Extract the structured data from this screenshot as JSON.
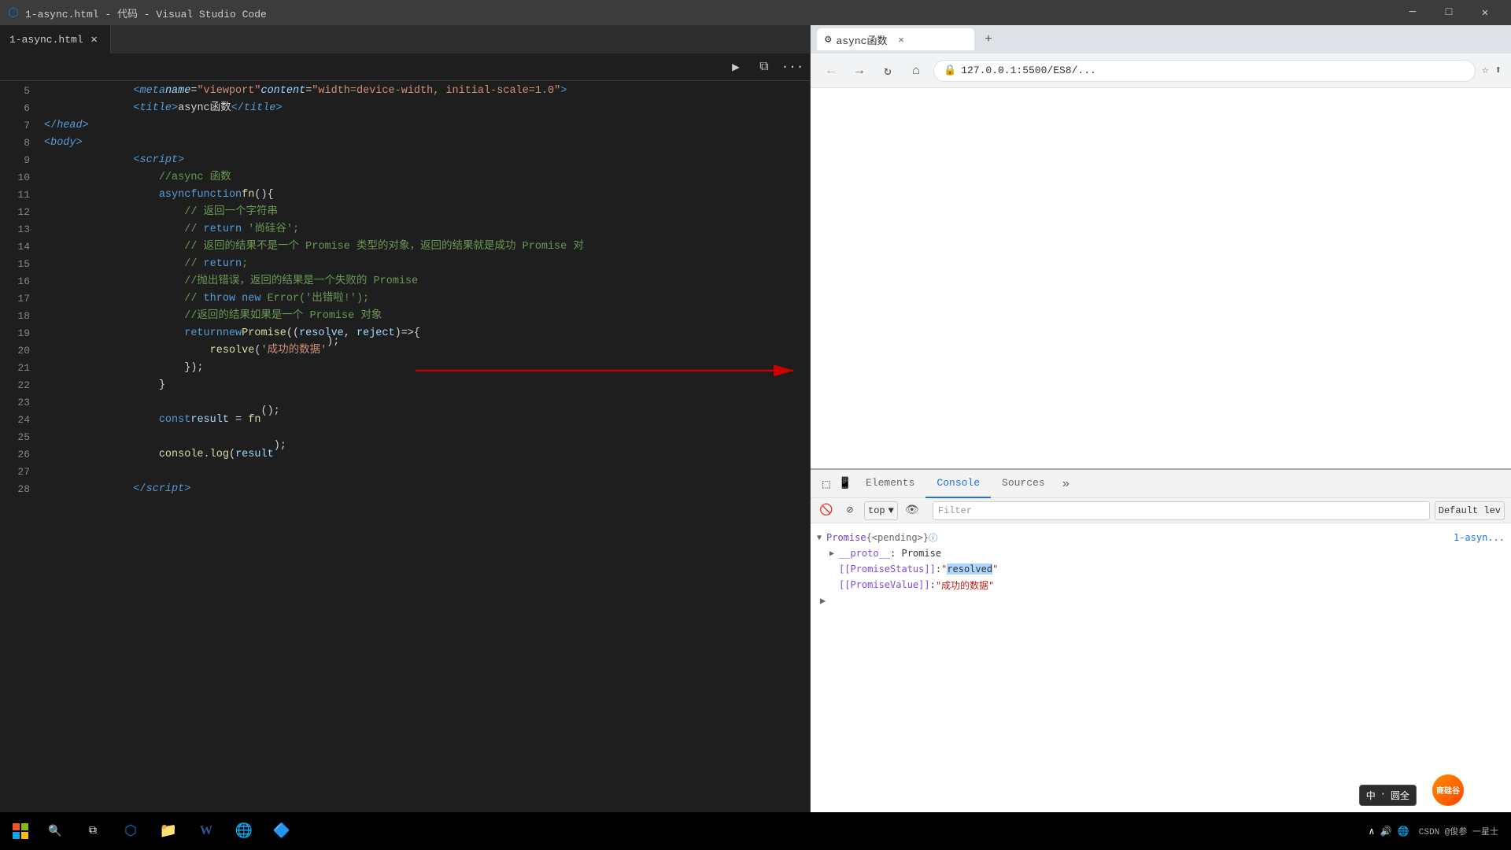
{
  "titleBar": {
    "title": "1-async.html - 代码 - Visual Studio Code",
    "icon": "⬡",
    "minimize": "─",
    "maximize": "□",
    "close": "✕"
  },
  "editor": {
    "tabName": "1-async.html",
    "lines": [
      {
        "num": 5,
        "content": "meta_viewport"
      },
      {
        "num": 6,
        "content": "title_async"
      },
      {
        "num": 7,
        "content": "head_close"
      },
      {
        "num": 8,
        "content": "body_open"
      },
      {
        "num": 9,
        "content": "script_open"
      },
      {
        "num": 10,
        "content": "comment_async"
      },
      {
        "num": 11,
        "content": "fn_def"
      },
      {
        "num": 12,
        "content": "comment1"
      },
      {
        "num": 13,
        "content": "comment2"
      },
      {
        "num": 14,
        "content": "comment3"
      },
      {
        "num": 15,
        "content": "comment4"
      },
      {
        "num": 16,
        "content": "comment5"
      },
      {
        "num": 17,
        "content": "comment6"
      },
      {
        "num": 18,
        "content": "comment7"
      },
      {
        "num": 19,
        "content": "return_promise"
      },
      {
        "num": 20,
        "content": "resolve_call"
      },
      {
        "num": 21,
        "content": "close_fn"
      },
      {
        "num": 22,
        "content": "close_brace"
      },
      {
        "num": 23,
        "content": "empty"
      },
      {
        "num": 24,
        "content": "const_result"
      },
      {
        "num": 25,
        "content": "empty"
      },
      {
        "num": 26,
        "content": "console_log"
      },
      {
        "num": 27,
        "content": "empty"
      },
      {
        "num": 28,
        "content": "script_close"
      }
    ]
  },
  "browser": {
    "tabTitle": "async函数",
    "url": "127.0.0.1:5500/ES8/...",
    "favicon": "🔒"
  },
  "devtools": {
    "tabs": [
      "Elements",
      "Console",
      "Sources"
    ],
    "activeTab": "Console",
    "moreLabel": "»",
    "contextSelect": "top",
    "filterPlaceholder": "Filter",
    "defaultLevel": "Default lev",
    "consoleFilename": "1-asyn...",
    "promise": {
      "label": "Promise {<pending>}",
      "infoIcon": "ⓘ",
      "proto": "__proto__: Promise",
      "statusKey": "[[PromiseStatus]]",
      "statusValue": "\"resolved\"",
      "valueKey": "[[PromiseValue]]",
      "valueText": "\"成功的数据\"",
      "expandIcon": "▶"
    }
  },
  "taskbar": {
    "startIcon": "⊞",
    "items": [
      "⊟",
      "📁",
      "W",
      "🌐",
      "🔷"
    ],
    "csdn": "CSDN @俊参 一星士"
  },
  "ime": {
    "label1": "中",
    "label2": "·",
    "label3": "圆全",
    "sogouLabel": "商硅谷"
  }
}
